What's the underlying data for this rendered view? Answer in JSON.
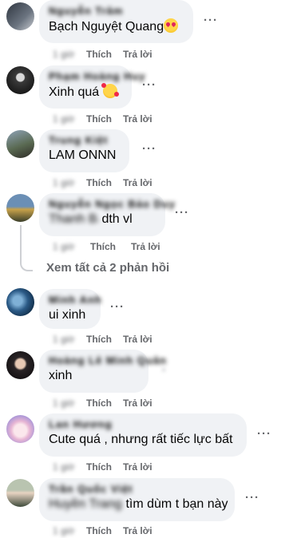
{
  "actions": {
    "like_label": "Thích",
    "reply_label": "Trả lời",
    "time": "1 giờ",
    "more_label": "···"
  },
  "view_replies_label": "Xem tất cả 2 phản hồi",
  "comments": [
    {
      "name": "Nguyễn Trâm",
      "text": "Bạch Nguyệt Quang",
      "emoji": "heart-eyes-emoji"
    },
    {
      "name": "Phạm Hoàng Huy",
      "text": "Xinh quá",
      "emoji": "smiling-hearts-emoji"
    },
    {
      "name": "Trung Kiệt",
      "text": "LAM ONNN"
    },
    {
      "name": "Nguyễn Ngọc Bảo Duy",
      "text_blur": "Thanh Bảo",
      "text": "dth vl"
    },
    {
      "name": "Minh Anh",
      "text": "ui xinh"
    },
    {
      "name": "Hoàng Lê Minh Quân",
      "text": "xinh"
    },
    {
      "name": "Lan Hương",
      "text": "Cute quá , nhưng rất tiếc lực bất"
    },
    {
      "name": "Trần Quốc Việt",
      "text_blur": "Huyền Trang",
      "text": "tìm dùm t bạn này"
    }
  ],
  "colors": {
    "bubble": "#f0f2f5",
    "meta": "#65676b",
    "text": "#050505"
  }
}
